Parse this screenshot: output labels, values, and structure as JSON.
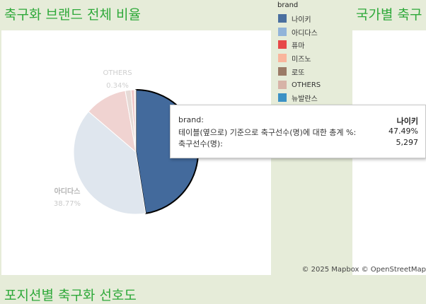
{
  "titles": {
    "main": "축구화 브랜드 전체 비율",
    "map": "국가별 축구",
    "bottom": "포지션별 축구화 선호도"
  },
  "legend": {
    "title": "brand",
    "items": [
      {
        "label": "나이키",
        "color": "#4a6f9f"
      },
      {
        "label": "아디다스",
        "color": "#91b4d9"
      },
      {
        "label": "퓨마",
        "color": "#e74848"
      },
      {
        "label": "미즈노",
        "color": "#f9b59c"
      },
      {
        "label": "로또",
        "color": "#9b7b67"
      },
      {
        "label": "OTHERS",
        "color": "#d7b3a7"
      },
      {
        "label": "뉴발란스",
        "color": "#3b91c5"
      }
    ]
  },
  "pie": {
    "labels": {
      "others_name": "OTHERS",
      "others_pct": "0.34%",
      "adidas_name": "아디다스",
      "adidas_pct": "38.77%"
    }
  },
  "chart_data": {
    "type": "pie",
    "title": "축구화 브랜드 전체 비율",
    "slices": [
      {
        "label": "나이키",
        "value": 47.49,
        "color": "#436a9c",
        "highlighted": true
      },
      {
        "label": "아디다스",
        "value": 38.77,
        "color": "#dfe6ee"
      },
      {
        "label": "미즈노",
        "value": 11.0,
        "color": "#f0d3d1"
      },
      {
        "label": "로또",
        "value": 1.5,
        "color": "#e6dad6"
      },
      {
        "label": "퓨마",
        "value": 0.9,
        "color": "#f0c9c9"
      },
      {
        "label": "OTHERS",
        "value": 0.34,
        "color": "#ece7e5"
      }
    ]
  },
  "tooltip": {
    "brand_label": "brand:",
    "brand_value": "나이키",
    "pct_label": "테이블(옆으로) 기준으로 축구선수(명)에 대한 총계 %:",
    "pct_value": "47.49%",
    "count_label": "축구선수(명):",
    "count_value": "5,297"
  },
  "map": {
    "credit": "© 2025 Mapbox  © OpenStreetMap"
  }
}
